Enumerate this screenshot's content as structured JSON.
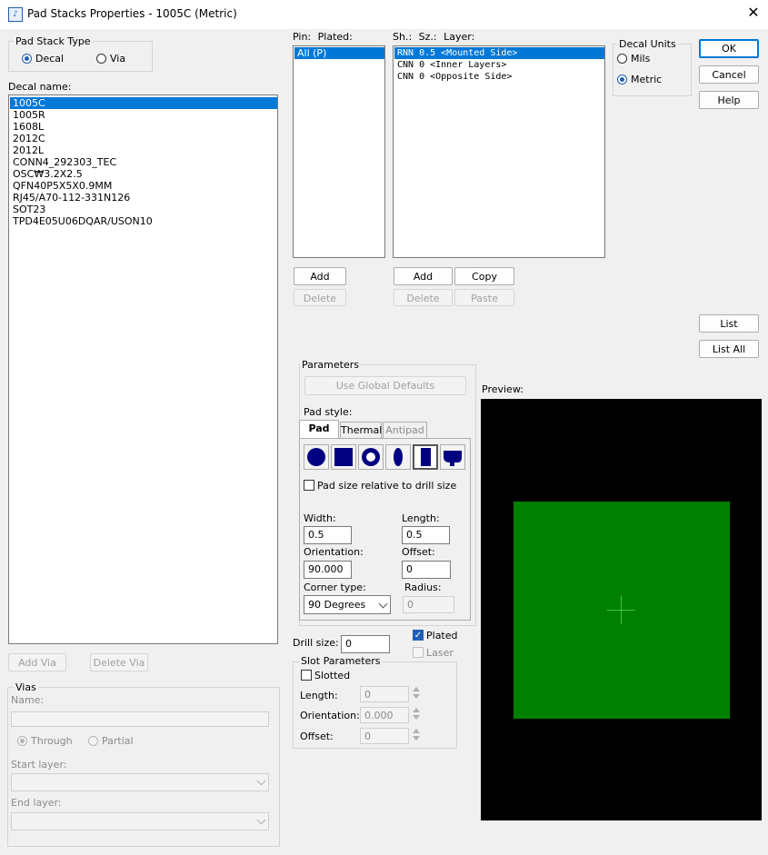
{
  "window": {
    "title": "Pad Stacks Properties - 1005C (Metric)"
  },
  "pad_stack_type": {
    "label": "Pad Stack Type",
    "decal_label": "Decal",
    "via_label": "Via",
    "selected": "Decal"
  },
  "decal_name": {
    "label": "Decal name:",
    "items": [
      "1005C",
      "1005R",
      "1608L",
      "2012C",
      "2012L",
      "CONN4_292303_TEC",
      "OSC₩3.2X2.5",
      "QFN40P5X5X0.9MM",
      "RJ45/A70-112-331N126",
      "SOT23",
      "TPD4E05U06DQAR/USON10"
    ],
    "selected_index": 0
  },
  "pin_list": {
    "header_pin": "Pin:",
    "header_plated": "Plated:",
    "items": [
      "All (P)"
    ]
  },
  "layer_list": {
    "header_sh": "Sh.:",
    "header_sz": "Sz.:",
    "header_layer": "Layer:",
    "items": [
      "RNN 0.5 <Mounted Side>",
      "CNN 0 <Inner Layers>",
      "CNN 0 <Opposite Side>"
    ]
  },
  "decal_units": {
    "label": "Decal Units",
    "mils_label": "Mils",
    "metric_label": "Metric",
    "selected": "Metric"
  },
  "buttons": {
    "ok": "OK",
    "cancel": "Cancel",
    "help": "Help",
    "list": "List",
    "list_all": "List All",
    "pin_add": "Add",
    "pin_delete": "Delete",
    "layer_add": "Add",
    "layer_copy": "Copy",
    "layer_delete": "Delete",
    "layer_paste": "Paste",
    "add_via": "Add Via",
    "delete_via": "Delete Via",
    "use_global_defaults": "Use Global Defaults"
  },
  "parameters": {
    "label": "Parameters",
    "pad_style_label": "Pad style:",
    "tabs": [
      "Pad",
      "Thermal",
      "Antipad"
    ],
    "active_tab": "Pad",
    "shapes": [
      "round-pad-icon",
      "square-pad-icon",
      "annular-pad-icon",
      "oval-pad-icon",
      "rectangle-pad-icon",
      "odd-shape-pad-icon"
    ],
    "selected_shape": "rectangle-pad-icon",
    "relative_label": "Pad size relative to drill size",
    "width_label": "Width:",
    "width_value": "0.5",
    "length_label": "Length:",
    "length_value": "0.5",
    "orientation_label": "Orientation:",
    "orientation_value": "90.000",
    "offset_label": "Offset:",
    "offset_value": "0",
    "corner_type_label": "Corner type:",
    "corner_type_value": "90 Degrees",
    "radius_label": "Radius:",
    "radius_value": "0"
  },
  "drill": {
    "label": "Drill size:",
    "value": "0",
    "plated_label": "Plated",
    "plated_checked": true,
    "laser_label": "Laser",
    "laser_checked": false
  },
  "slot": {
    "label": "Slot Parameters",
    "slotted_label": "Slotted",
    "length_label": "Length:",
    "length_value": "0",
    "orientation_label": "Orientation:",
    "orientation_value": "0.000",
    "offset_label": "Offset:",
    "offset_value": "0"
  },
  "preview": {
    "label": "Preview:",
    "background": "#000000",
    "pad_color": "#008000",
    "crosshair_color": "#33cc33"
  },
  "vias": {
    "label": "Vias",
    "name_label": "Name:",
    "through_label": "Through",
    "partial_label": "Partial",
    "start_layer_label": "Start layer:",
    "end_layer_label": "End layer:"
  }
}
